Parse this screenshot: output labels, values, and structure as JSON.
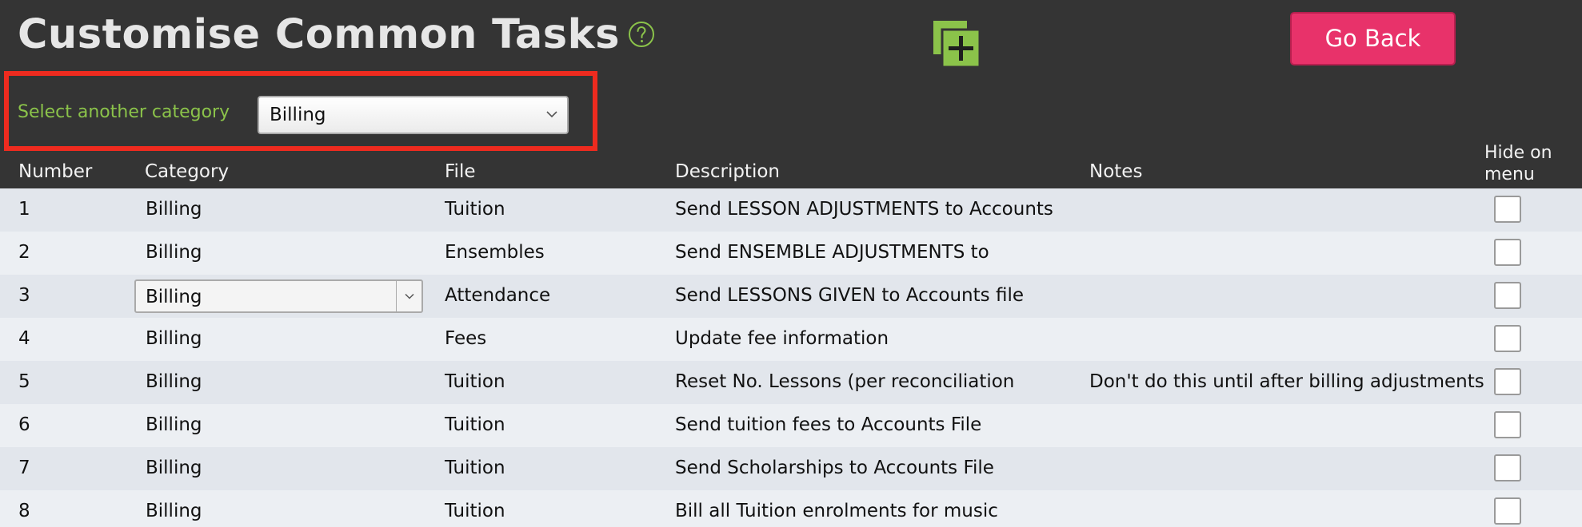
{
  "header": {
    "title": "Customise Common Tasks",
    "go_back_label": "Go Back",
    "help_icon": "help-circle-icon",
    "add_icon": "add-copy-icon"
  },
  "category_filter": {
    "label": "Select another category",
    "selected": "Billing"
  },
  "colors": {
    "background": "#343434",
    "accent_green": "#8bc34a",
    "go_back": "#e8326a",
    "highlight": "#ee2b1f"
  },
  "table": {
    "columns": {
      "number": "Number",
      "category": "Category",
      "file": "File",
      "description": "Description",
      "notes": "Notes",
      "hide_line1": "Hide on",
      "hide_line2": "menu"
    },
    "rows": [
      {
        "number": "1",
        "category": "Billing",
        "file": "Tuition",
        "description": "Send LESSON ADJUSTMENTS to Accounts",
        "notes": "",
        "hidden": false,
        "editing": false
      },
      {
        "number": "2",
        "category": "Billing",
        "file": "Ensembles",
        "description": "Send ENSEMBLE ADJUSTMENTS to",
        "notes": "",
        "hidden": false,
        "editing": false
      },
      {
        "number": "3",
        "category": "Billing",
        "file": "Attendance",
        "description": "Send LESSONS GIVEN to Accounts file",
        "notes": "",
        "hidden": false,
        "editing": true
      },
      {
        "number": "4",
        "category": "Billing",
        "file": "Fees",
        "description": "Update fee information",
        "notes": "",
        "hidden": false,
        "editing": false
      },
      {
        "number": "5",
        "category": "Billing",
        "file": "Tuition",
        "description": "Reset No. Lessons (per reconciliation",
        "notes": "Don't do this until after billing adjustments",
        "hidden": false,
        "editing": false
      },
      {
        "number": "6",
        "category": "Billing",
        "file": "Tuition",
        "description": "Send tuition fees to Accounts File",
        "notes": "",
        "hidden": false,
        "editing": false
      },
      {
        "number": "7",
        "category": "Billing",
        "file": "Tuition",
        "description": "Send Scholarships to Accounts File",
        "notes": "",
        "hidden": false,
        "editing": false
      },
      {
        "number": "8",
        "category": "Billing",
        "file": "Tuition",
        "description": "Bill all Tuition enrolments for music",
        "notes": "",
        "hidden": false,
        "editing": false
      }
    ]
  }
}
